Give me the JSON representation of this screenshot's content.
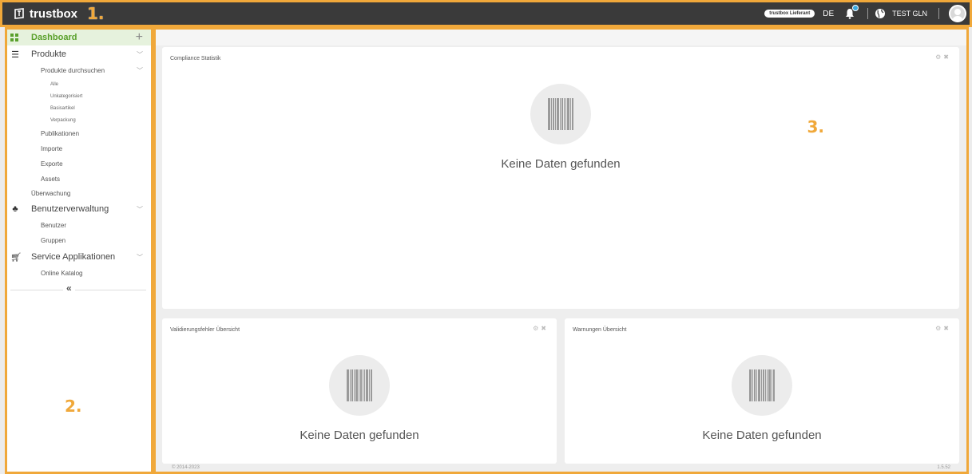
{
  "topbar": {
    "brand": "trustbox",
    "annotation": "1.",
    "role_badge": "trustbox Lieferant",
    "language": "DE",
    "notification_count": "0",
    "user": "TEST GLN"
  },
  "sidebar": {
    "annotation": "2.",
    "dashboard": "Dashboard",
    "items": [
      {
        "label": "Produkte"
      },
      {
        "label": "Produkte durchsuchen"
      },
      {
        "label": "Alle"
      },
      {
        "label": "Unkategorisiert"
      },
      {
        "label": "Basisartikel"
      },
      {
        "label": "Verpackung"
      },
      {
        "label": "Publikationen"
      },
      {
        "label": "Importe"
      },
      {
        "label": "Exporte"
      },
      {
        "label": "Assets"
      },
      {
        "label": "Überwachung"
      },
      {
        "label": "Benutzerverwaltung"
      },
      {
        "label": "Benutzer"
      },
      {
        "label": "Gruppen"
      },
      {
        "label": "Service Applikationen"
      },
      {
        "label": "Online Katalog"
      }
    ],
    "collapse": "«"
  },
  "main": {
    "annotation": "3.",
    "panels": [
      {
        "title": "Compliance Statistik",
        "empty": "Keine Daten gefunden"
      },
      {
        "title": "Validierungsfehler Übersicht",
        "empty": "Keine Daten gefunden"
      },
      {
        "title": "Warnungen Übersicht",
        "empty": "Keine Daten gefunden"
      }
    ],
    "footer_left": "© 2014-2023",
    "footer_right": "1.5.52"
  },
  "colors": {
    "accent": "#5aa02c",
    "annotation": "#f0a83a",
    "topbar": "#3a3a3a",
    "badge": "#3aa8e0"
  }
}
